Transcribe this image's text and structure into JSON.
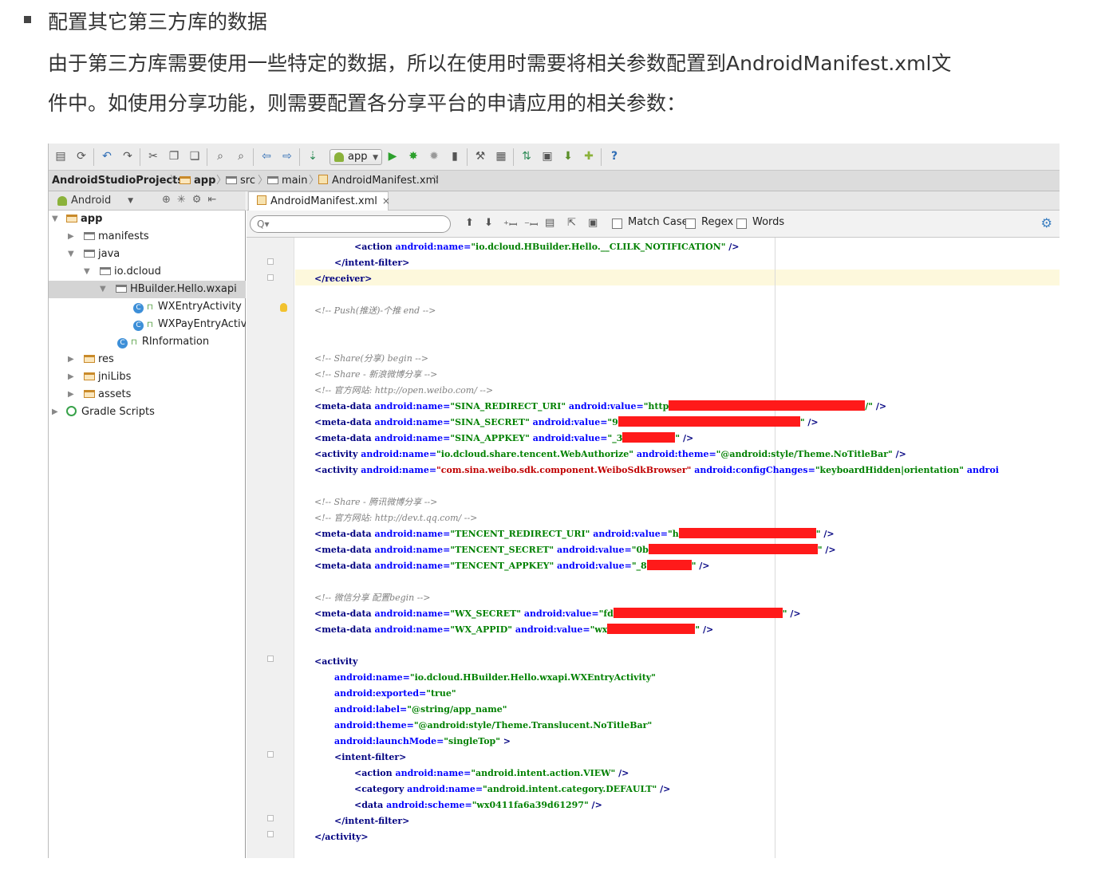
{
  "article": {
    "heading": "配置其它第三方库的数据",
    "paragraph_line1": "由于第三方库需要使用一些特定的数据，所以在使用时需要将相关参数配置到AndroidManifest.xml文",
    "paragraph_line2": "件中。如使用分享功能，则需要配置各分享平台的申请应用的相关参数："
  },
  "toolbar": {
    "run_config": "app",
    "icons": [
      "save-icon",
      "sync-icon",
      "undo-icon",
      "redo-icon",
      "cut-icon",
      "copy-icon",
      "paste-icon",
      "find-icon",
      "replace-icon",
      "back-icon",
      "forward-icon",
      "build-icon",
      "run-icon",
      "debug-icon",
      "attach-icon",
      "avd-icon",
      "project-structure-icon",
      "settings-icon",
      "gradle-sync-icon",
      "device-monitor-icon",
      "sdk-manager-icon",
      "android-icon",
      "help-icon"
    ]
  },
  "breadcrumb": {
    "items": [
      "AndroidStudioProjects",
      "app",
      "src",
      "main",
      "AndroidManifest.xml"
    ]
  },
  "project_pane": {
    "view_mode": "Android",
    "tree": [
      {
        "label": "app",
        "level": 0,
        "expanded": true
      },
      {
        "label": "manifests",
        "level": 1,
        "expanded": false
      },
      {
        "label": "java",
        "level": 1,
        "expanded": true
      },
      {
        "label": "io.dcloud",
        "level": 2,
        "expanded": true
      },
      {
        "label": "HBuilder.Hello.wxapi",
        "level": 3,
        "expanded": true,
        "selected": true
      },
      {
        "label": "WXEntryActivity",
        "level": 4
      },
      {
        "label": "WXPayEntryActivity",
        "level": 4
      },
      {
        "label": "RInformation",
        "level": 3
      },
      {
        "label": "res",
        "level": 1,
        "expanded": false
      },
      {
        "label": "jniLibs",
        "level": 1,
        "expanded": false
      },
      {
        "label": "assets",
        "level": 1,
        "expanded": false
      },
      {
        "label": "Gradle Scripts",
        "level": 0,
        "expanded": false
      }
    ]
  },
  "editor": {
    "tab_label": "AndroidManifest.xml",
    "tab_close": "×",
    "search": {
      "placeholder": "Q▾",
      "match_case": "Match Case",
      "regex": "Regex",
      "words": "Words"
    },
    "code": {
      "l01": [
        "<action ",
        "android:name=",
        "\"io.dcloud.HBuilder.Hello.__CLILK_NOTIFICATION\"",
        " />"
      ],
      "l02": "</intent-filter>",
      "l03": "</receiver>",
      "l04": "<!-- Push(推送)-个推   end -->",
      "l05": "<!-- Share(分享) begin -->",
      "l06": "<!-- Share - 新浪微博分享 -->",
      "l07": "<!-- 官方网站: http://open.weibo.com/ -->",
      "l08": [
        "<meta-data ",
        "android:name=",
        "\"SINA_REDIRECT_URI\"",
        " android:value=",
        "\"http",
        "/\"",
        " />"
      ],
      "l09": [
        "<meta-data ",
        "android:name=",
        "\"SINA_SECRET\"",
        " android:value=",
        "\"9",
        "\"",
        " />"
      ],
      "l10": [
        "<meta-data ",
        "android:name=",
        "\"SINA_APPKEY\"",
        " android:value=",
        "\"_3",
        "\"",
        " />"
      ],
      "l11": [
        "<activity ",
        "android:name=",
        "\"io.dcloud.share.tencent.WebAuthorize\"",
        " android:theme=",
        "\"@android:style/Theme.NoTitleBar\"",
        " />"
      ],
      "l12": [
        "<activity ",
        "android:name=",
        "\"com.sina.weibo.sdk.component.WeiboSdkBrowser\"",
        " android:configChanges=",
        "\"keyboardHidden|orientation\"",
        "  androi"
      ],
      "l13": "<!-- Share - 腾讯微博分享 -->",
      "l14": "<!-- 官方网站: http://dev.t.qq.com/ -->",
      "l15": [
        "<meta-data ",
        "android:name=",
        "\"TENCENT_REDIRECT_URI\"",
        " android:value=",
        "\"h",
        "\"",
        " />"
      ],
      "l16": [
        "<meta-data ",
        "android:name=",
        "\"TENCENT_SECRET\"",
        " android:value=",
        "\"0b",
        "\"",
        " />"
      ],
      "l17": [
        "<meta-data ",
        "android:name=",
        "\"TENCENT_APPKEY\"",
        " android:value=",
        "\"_8",
        "\"",
        " />"
      ],
      "l18": "<!-- 微信分享 配置begin -->",
      "l19": [
        "<meta-data ",
        "android:name=",
        "\"WX_SECRET\"",
        " android:value=",
        "\"fd",
        "\"",
        " />"
      ],
      "l20": [
        "<meta-data ",
        "android:name=",
        "\"WX_APPID\"",
        " android:value=",
        "\"wx",
        "\"",
        " />"
      ],
      "l21": "<activity",
      "l22": [
        "android:name=",
        "\"io.dcloud.HBuilder.Hello.wxapi.WXEntryActivity\""
      ],
      "l23": [
        "android:exported=",
        "\"true\""
      ],
      "l24": [
        "android:label=",
        "\"@string/app_name\""
      ],
      "l25": [
        "android:theme=",
        "\"@android:style/Theme.Translucent.NoTitleBar\""
      ],
      "l26": [
        "android:launchMode=",
        "\"singleTop\"",
        " >"
      ],
      "l27": "<intent-filter>",
      "l28": [
        "<action ",
        "android:name=",
        "\"android.intent.action.VIEW\"",
        " />"
      ],
      "l29": [
        "<category ",
        "android:name=",
        "\"android.intent.category.DEFAULT\"",
        " />"
      ],
      "l30": [
        "<data ",
        "android:scheme=",
        "\"wx0411fa6a39d61297\"",
        " />"
      ],
      "l31": "</intent-filter>",
      "l32": "</activity>"
    }
  },
  "colors": {
    "xml_tag": "#000080",
    "xml_attr": "#0000ff",
    "xml_value": "#008000",
    "xml_comment": "#808080",
    "redaction": "#ff1a1a",
    "caret_line": "#fdf8dc"
  }
}
